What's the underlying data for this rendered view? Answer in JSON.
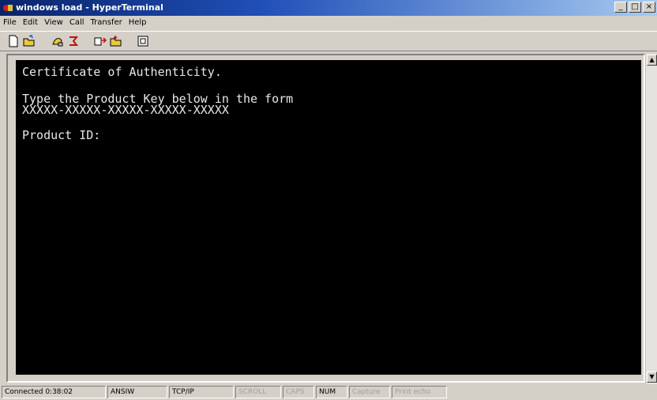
{
  "window": {
    "title": "windows load - HyperTerminal",
    "minimize": "_",
    "maximize": "□",
    "close": "×"
  },
  "menu": [
    "File",
    "Edit",
    "View",
    "Call",
    "Transfer",
    "Help"
  ],
  "toolbar": {
    "icons": [
      "new-icon",
      "open-icon",
      "connect-icon",
      "disconnect-icon",
      "send-icon",
      "receive-icon",
      "properties-icon"
    ]
  },
  "terminal": {
    "lines": [
      "Certificate of Authenticity.",
      "Type the Product Key below in the form",
      "XXXXX-XXXXX-XXXXX-XXXXX-XXXXX",
      "Product ID:"
    ]
  },
  "status": {
    "connected": "Connected 0:38:02",
    "emulation": "ANSIW",
    "protocol": "TCP/IP",
    "scroll": "SCROLL",
    "caps": "CAPS",
    "num": "NUM",
    "capture": "Capture",
    "printecho": "Print echo"
  },
  "colors": {
    "terminal_bg": "#000000",
    "terminal_fg": "#e8e8e8",
    "title_bg": "#0a246a"
  }
}
